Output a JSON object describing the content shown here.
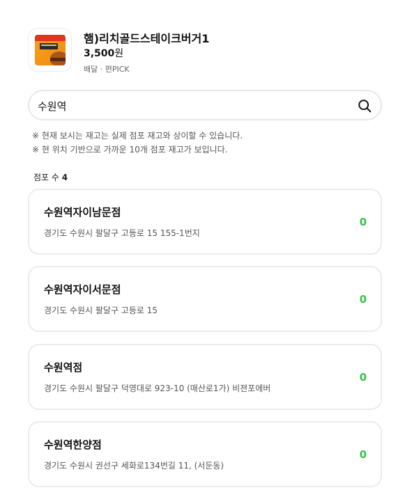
{
  "product": {
    "name": "햄)리치골드스테이크버거1",
    "price": "3,500",
    "currency": "원",
    "meta": "배달 · 편PICK",
    "image_icon": "burger-package-icon"
  },
  "search": {
    "value": "수원역",
    "icon": "search-icon"
  },
  "notices": [
    "※ 현재 보시는 재고는 실제 점포 재고와 상이할 수 있습니다.",
    "※ 현 위치 기반으로 가까운 10개 점포 재고가 보입니다."
  ],
  "store_count": {
    "label": "점포 수",
    "value": "4"
  },
  "stores": [
    {
      "name": "수원역자이남문점",
      "address": "경기도 수원시 팔달구 고등로 15 155-1번지",
      "stock": "0"
    },
    {
      "name": "수원역자이서문점",
      "address": "경기도 수원시 팔달구 고등로 15",
      "stock": "0"
    },
    {
      "name": "수원역점",
      "address": "경기도 수원시 팔달구 덕영대로 923-10 (매산로1가) 비젼포에버",
      "stock": "0"
    },
    {
      "name": "수원역한양점",
      "address": "경기도 수원시 권선구 세화로134번길 11, (서둔동)",
      "stock": "0"
    }
  ],
  "colors": {
    "stock_green": "#35c24b",
    "border": "#ececec"
  }
}
